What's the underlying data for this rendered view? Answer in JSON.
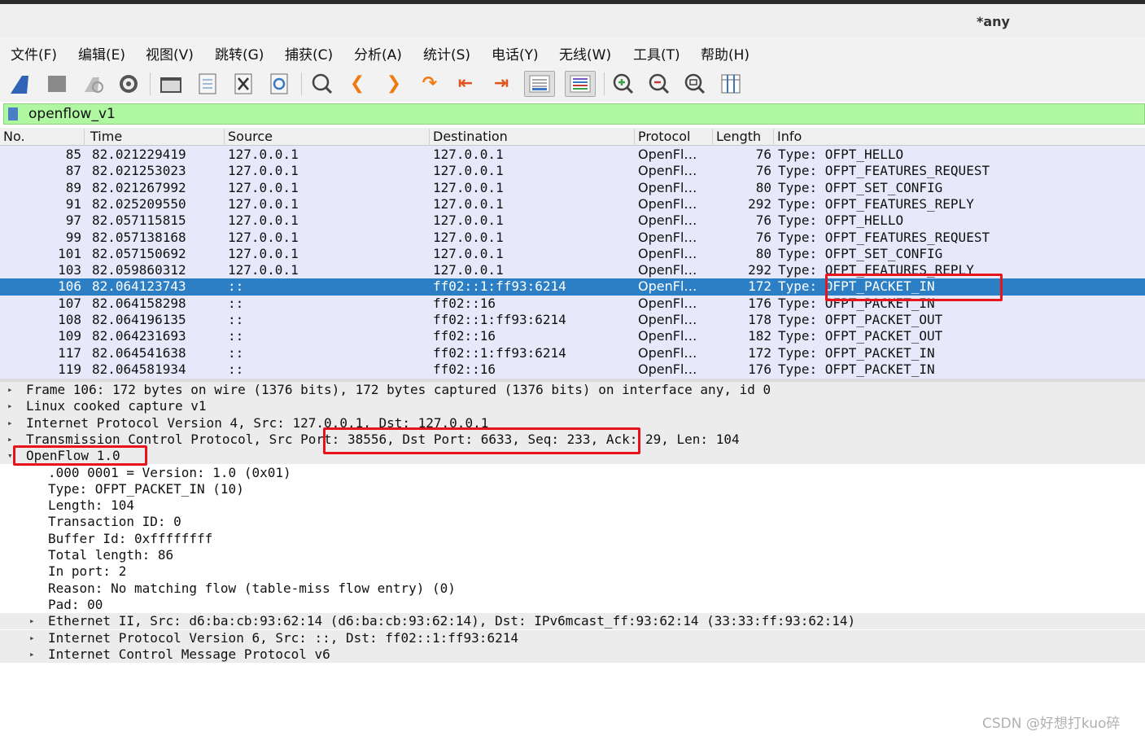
{
  "window": {
    "title": "*any"
  },
  "menu": [
    "文件(F)",
    "编辑(E)",
    "视图(V)",
    "跳转(G)",
    "捕获(C)",
    "分析(A)",
    "统计(S)",
    "电话(Y)",
    "无线(W)",
    "工具(T)",
    "帮助(H)"
  ],
  "toolbar_icons": [
    "shark-fin-icon",
    "stop-icon",
    "restart-icon",
    "options-gear-icon",
    "open-folder-icon",
    "save-file-icon",
    "close-file-icon",
    "reload-icon",
    "find-icon",
    "go-back-icon",
    "go-forward-icon",
    "go-to-packet-icon",
    "first-packet-icon",
    "last-packet-icon",
    "autoscroll-icon",
    "colorize-icon",
    "zoom-in-icon",
    "zoom-out-icon",
    "normal-size-icon",
    "resize-columns-icon"
  ],
  "filter": {
    "value": "openflow_v1"
  },
  "columns": [
    "No.",
    "Time",
    "Source",
    "Destination",
    "Protocol",
    "Length",
    "Info"
  ],
  "packets": [
    {
      "no": "85",
      "time": "82.021229419",
      "src": "127.0.0.1",
      "dst": "127.0.0.1",
      "proto": "OpenFl…",
      "len": "76",
      "info": "Type: OFPT_HELLO"
    },
    {
      "no": "87",
      "time": "82.021253023",
      "src": "127.0.0.1",
      "dst": "127.0.0.1",
      "proto": "OpenFl…",
      "len": "76",
      "info": "Type: OFPT_FEATURES_REQUEST"
    },
    {
      "no": "89",
      "time": "82.021267992",
      "src": "127.0.0.1",
      "dst": "127.0.0.1",
      "proto": "OpenFl…",
      "len": "80",
      "info": "Type: OFPT_SET_CONFIG"
    },
    {
      "no": "91",
      "time": "82.025209550",
      "src": "127.0.0.1",
      "dst": "127.0.0.1",
      "proto": "OpenFl…",
      "len": "292",
      "info": "Type: OFPT_FEATURES_REPLY"
    },
    {
      "no": "97",
      "time": "82.057115815",
      "src": "127.0.0.1",
      "dst": "127.0.0.1",
      "proto": "OpenFl…",
      "len": "76",
      "info": "Type: OFPT_HELLO"
    },
    {
      "no": "99",
      "time": "82.057138168",
      "src": "127.0.0.1",
      "dst": "127.0.0.1",
      "proto": "OpenFl…",
      "len": "76",
      "info": "Type: OFPT_FEATURES_REQUEST"
    },
    {
      "no": "101",
      "time": "82.057150692",
      "src": "127.0.0.1",
      "dst": "127.0.0.1",
      "proto": "OpenFl…",
      "len": "80",
      "info": "Type: OFPT_SET_CONFIG"
    },
    {
      "no": "103",
      "time": "82.059860312",
      "src": "127.0.0.1",
      "dst": "127.0.0.1",
      "proto": "OpenFl…",
      "len": "292",
      "info": "Type: OFPT_FEATURES_REPLY"
    },
    {
      "no": "106",
      "time": "82.064123743",
      "src": "::",
      "dst": "ff02::1:ff93:6214",
      "proto": "OpenFl…",
      "len": "172",
      "info": "Type: OFPT_PACKET_IN"
    },
    {
      "no": "107",
      "time": "82.064158298",
      "src": "::",
      "dst": "ff02::16",
      "proto": "OpenFl…",
      "len": "176",
      "info": "Type: OFPT_PACKET_IN"
    },
    {
      "no": "108",
      "time": "82.064196135",
      "src": "::",
      "dst": "ff02::1:ff93:6214",
      "proto": "OpenFl…",
      "len": "178",
      "info": "Type: OFPT_PACKET_OUT"
    },
    {
      "no": "109",
      "time": "82.064231693",
      "src": "::",
      "dst": "ff02::16",
      "proto": "OpenFl…",
      "len": "182",
      "info": "Type: OFPT_PACKET_OUT"
    },
    {
      "no": "117",
      "time": "82.064541638",
      "src": "::",
      "dst": "ff02::1:ff93:6214",
      "proto": "OpenFl…",
      "len": "172",
      "info": "Type: OFPT_PACKET_IN"
    },
    {
      "no": "119",
      "time": "82.064581934",
      "src": "::",
      "dst": "ff02::16",
      "proto": "OpenFl…",
      "len": "176",
      "info": "Type: OFPT_PACKET_IN"
    }
  ],
  "selected_packet_no": "106",
  "details": [
    {
      "text": "Frame 106: 172 bytes on wire (1376 bits), 172 bytes captured (1376 bits) on interface any, id 0",
      "expander": "collapsed"
    },
    {
      "text": "Linux cooked capture v1",
      "expander": "collapsed"
    },
    {
      "text": "Internet Protocol Version 4, Src: 127.0.0.1, Dst: 127.0.0.1",
      "expander": "collapsed"
    },
    {
      "text": "Transmission Control Protocol, Src Port: 38556, Dst Port: 6633, Seq: 233, Ack: 29, Len: 104",
      "expander": "collapsed"
    },
    {
      "text": "OpenFlow 1.0",
      "expander": "expanded"
    },
    {
      "text": ".000 0001 = Version: 1.0 (0x01)",
      "expander": "none"
    },
    {
      "text": "Type: OFPT_PACKET_IN (10)",
      "expander": "none"
    },
    {
      "text": "Length: 104",
      "expander": "none"
    },
    {
      "text": "Transaction ID: 0",
      "expander": "none"
    },
    {
      "text": "Buffer Id: 0xffffffff",
      "expander": "none"
    },
    {
      "text": "Total length: 86",
      "expander": "none"
    },
    {
      "text": "In port: 2",
      "expander": "none"
    },
    {
      "text": "Reason: No matching flow (table-miss flow entry) (0)",
      "expander": "none"
    },
    {
      "text": "Pad: 00",
      "expander": "none"
    },
    {
      "text": "Ethernet II, Src: d6:ba:cb:93:62:14 (d6:ba:cb:93:62:14), Dst: IPv6mcast_ff:93:62:14 (33:33:ff:93:62:14)",
      "expander": "collapsed"
    },
    {
      "text": "Internet Protocol Version 6, Src: ::, Dst: ff02::1:ff93:6214",
      "expander": "collapsed"
    },
    {
      "text": "Internet Control Message Protocol v6",
      "expander": "collapsed"
    }
  ],
  "highlight_color": "#e8141b",
  "selection_color": "#2c7fc5",
  "filter_bg_color": "#aff7a1",
  "watermark": "CSDN @好想打kuo碎"
}
